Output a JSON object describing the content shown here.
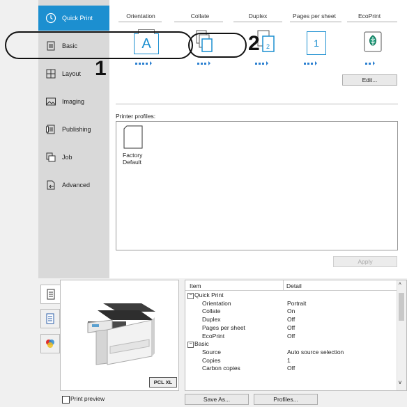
{
  "sidebar": {
    "items": [
      {
        "label": "Quick Print",
        "icon": "clock-icon"
      },
      {
        "label": "Basic",
        "icon": "document-icon"
      },
      {
        "label": "Layout",
        "icon": "layout-grid-icon"
      },
      {
        "label": "Imaging",
        "icon": "image-icon"
      },
      {
        "label": "Publishing",
        "icon": "publishing-icon"
      },
      {
        "label": "Job",
        "icon": "job-icon"
      },
      {
        "label": "Advanced",
        "icon": "advanced-icon"
      }
    ]
  },
  "settings": {
    "orientation_label": "Orientation",
    "orientation_glyph": "A",
    "collate_label": "Collate",
    "duplex_label": "Duplex",
    "pages_per_sheet_label": "Pages per sheet",
    "pages_per_sheet_value": "1",
    "ecoprint_label": "EcoPrint",
    "duplex_badge": "2",
    "edit_button": "Edit..."
  },
  "profiles": {
    "label": "Printer profiles:",
    "items": [
      {
        "name": "Factory Default"
      }
    ],
    "apply_button": "Apply"
  },
  "annotations": {
    "one": "1",
    "two": "2"
  },
  "preview": {
    "pcl_badge": "PCL XL",
    "print_preview_label": "Print preview"
  },
  "summary": {
    "headers": {
      "item": "Item",
      "detail": "Detail"
    },
    "rows": [
      {
        "item": "Quick Print",
        "detail": "",
        "group": true
      },
      {
        "item": "Orientation",
        "detail": "Portrait",
        "group": false
      },
      {
        "item": "Collate",
        "detail": "On",
        "group": false
      },
      {
        "item": "Duplex",
        "detail": "Off",
        "group": false
      },
      {
        "item": "Pages per sheet",
        "detail": "Off",
        "group": false
      },
      {
        "item": "EcoPrint",
        "detail": "Off",
        "group": false
      },
      {
        "item": "Basic",
        "detail": "",
        "group": true
      },
      {
        "item": "Source",
        "detail": "Auto source selection",
        "group": false
      },
      {
        "item": "Copies",
        "detail": "1",
        "group": false
      },
      {
        "item": "Carbon copies",
        "detail": "Off",
        "group": false
      }
    ]
  },
  "footer": {
    "save_as_button": "Save As...",
    "profiles_button": "Profiles..."
  },
  "colors": {
    "accent": "#1c8fd0",
    "annotation": "#111111"
  }
}
